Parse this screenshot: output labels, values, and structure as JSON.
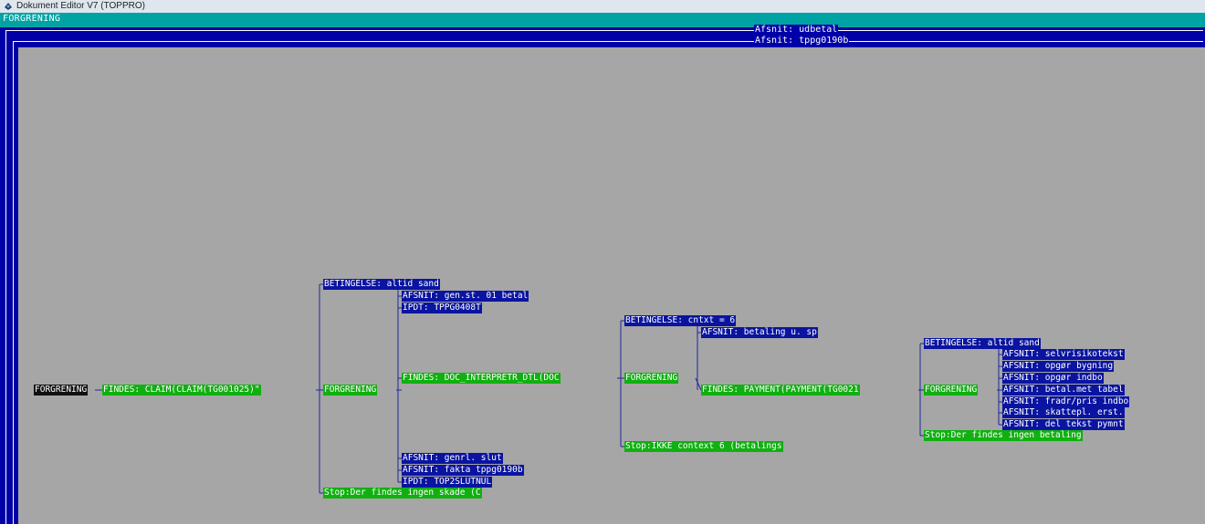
{
  "window": {
    "title": "Dokument Editor V7 (TOPPRO)",
    "menu_label": "FORGRENING"
  },
  "sections": [
    {
      "label": "Afsnit: udbetal"
    },
    {
      "label": "Afsnit: tppg0190b"
    }
  ],
  "tree": {
    "root": "FORGRENING",
    "findes1": "FINDES: CLAIM(CLAIM(TG001025)\"",
    "forgrening1": "FORGRENING",
    "betingelse1": "BETINGELSE: altid sand",
    "b1_items": [
      "AFSNIT: gen.st. 01 betal",
      "IPDT: TPPG0408T"
    ],
    "findes2": "FINDES: DOC_INTERPRETR_DTL(DOC",
    "forgrening2": "FORGRENING",
    "b2_items": [
      "AFSNIT: genrl. slut",
      "AFSNIT: fakta tppg0190b",
      "IPDT: TOP2SLUTNUL"
    ],
    "stop1": "Stop:Der findes ingen skade (C",
    "betingelse2": "BETINGELSE: cntxt = 6",
    "b3_items": [
      "AFSNIT: betaling u. sp"
    ],
    "findes3": "FINDES: PAYMENT(PAYMENT(TG0021",
    "forgrening3": "FORGRENING",
    "stop2": "Stop:IKKE context 6 (betalings",
    "betingelse3": "BETINGELSE: altid sand",
    "b4_items": [
      "AFSNIT: selvrisikotekst",
      "AFSNIT: opgør bygning",
      "AFSNIT: opgør indbo",
      "AFSNIT: betal.met tabel",
      "AFSNIT: fradr/pris indbo",
      "AFSNIT: skattepl. erst.",
      "AFSNIT: del tekst pymnt"
    ],
    "stop3": "Stop:Der findes ingen betaling"
  }
}
